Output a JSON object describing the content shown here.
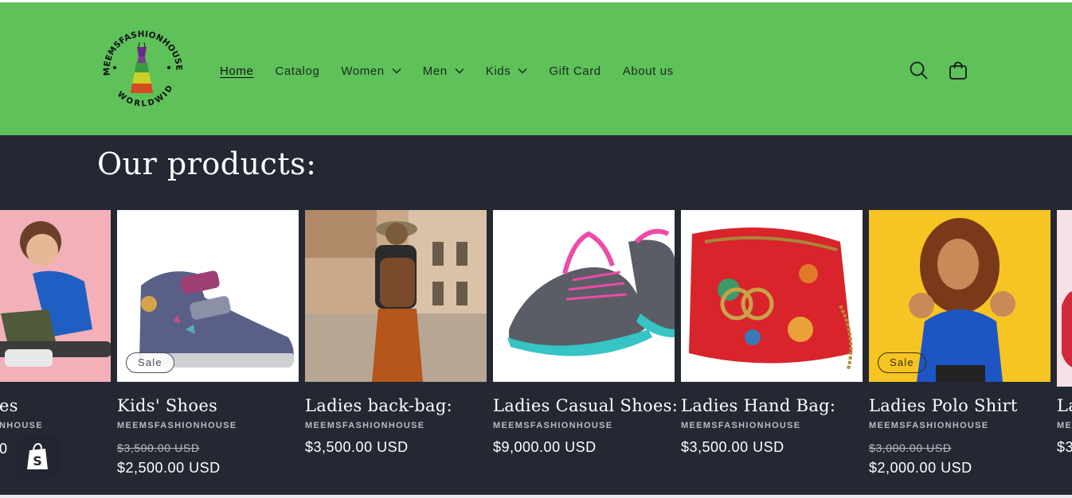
{
  "header": {
    "logo_top_text": "MEEMSFASHIONHOUSE",
    "logo_bottom_text": "WORLDWIDE",
    "nav": [
      {
        "label": "Home",
        "active": true,
        "dropdown": false
      },
      {
        "label": "Catalog",
        "active": false,
        "dropdown": false
      },
      {
        "label": "Women",
        "active": false,
        "dropdown": true
      },
      {
        "label": "Men",
        "active": false,
        "dropdown": true
      },
      {
        "label": "Kids",
        "active": false,
        "dropdown": true
      },
      {
        "label": "Gift Card",
        "active": false,
        "dropdown": false
      },
      {
        "label": "About us",
        "active": false,
        "dropdown": false
      }
    ],
    "icons": [
      "search-icon",
      "cart-icon"
    ],
    "background": "#5ec15a"
  },
  "section": {
    "title": "Our products:",
    "background": "#242833"
  },
  "products": [
    {
      "title": "Kids' Shoes",
      "vendor": "MEEMSFASHIONHOUSE",
      "price_old": "$3,500.00 USD",
      "price": "$2,500.00 USD",
      "badge": "Sale"
    },
    {
      "title": "Ladies back-bag:",
      "vendor": "MEEMSFASHIONHOUSE",
      "price": "$3,500.00 USD"
    },
    {
      "title": "Ladies Casual Shoes:",
      "vendor": "MEEMSFASHIONHOUSE",
      "price": "$9,000.00 USD"
    },
    {
      "title": "Ladies Hand Bag:",
      "vendor": "MEEMSFASHIONHOUSE",
      "price": "$3,500.00 USD"
    },
    {
      "title": "Ladies Polo Shirt",
      "vendor": "MEEMSFASHIONHOUSE",
      "price_old": "$3,000.00 USD",
      "price": "$2,000.00 USD",
      "badge": "Sale"
    }
  ],
  "partial_left": {
    "title_fragment": "es",
    "vendor_fragment": "NHOUSE",
    "price_fragment": "0"
  },
  "partial_right": {
    "title_fragment": "La",
    "vendor_fragment": "ME",
    "price_fragment": "$3"
  },
  "shopify_badge": "shopify-bag-icon"
}
